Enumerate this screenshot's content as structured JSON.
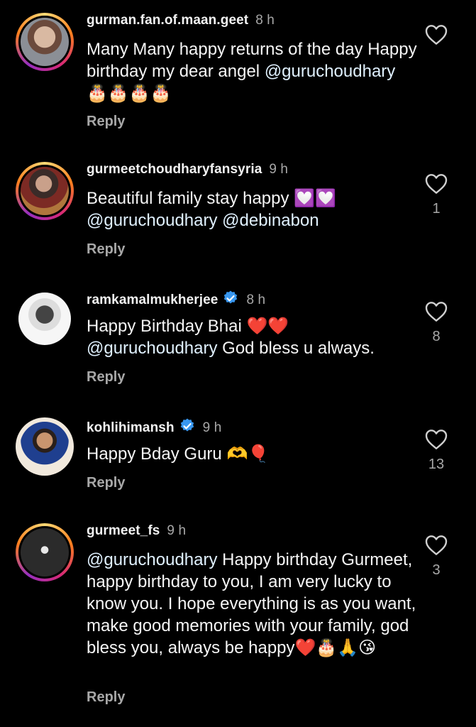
{
  "comments": [
    {
      "username": "gurman.fan.of.maan.geet",
      "time": "8 h",
      "verified": false,
      "text_parts": [
        "Many Many happy returns of the day Happy birthday my dear angel ",
        "@guruchoudhary",
        " 🎂🎂🎂🎂"
      ],
      "likes": "",
      "reply": "Reply"
    },
    {
      "username": "gurmeetchoudharyfansyria",
      "time": "9 h",
      "verified": false,
      "text_parts": [
        "Beautiful family stay happy 💟💟 ",
        "@guruchoudhary @debinabon",
        ""
      ],
      "likes": "1",
      "reply": "Reply"
    },
    {
      "username": "ramkamalmukherjee",
      "time": "8 h",
      "verified": true,
      "text_parts": [
        "Happy Birthday Bhai ❤️❤️ ",
        "@guruchoudhary",
        " God  bless u always."
      ],
      "likes": "8",
      "reply": "Reply"
    },
    {
      "username": "kohlihimansh",
      "time": "9 h",
      "verified": true,
      "text_parts": [
        "Happy Bday Guru 🫶🎈",
        "",
        ""
      ],
      "likes": "13",
      "reply": "Reply"
    },
    {
      "username": "gurmeet_fs",
      "time": "9 h",
      "verified": false,
      "text_parts": [
        "",
        "@guruchoudhary",
        " Happy birthday Gurmeet, happy birthday to you, I am very lucky to know you. I hope everything is as you want, make good memories with your family, god bless you, always be happy❤️🎂🙏😘"
      ],
      "likes": "3",
      "reply": "Reply"
    }
  ],
  "icons": {
    "like": "heart-outline-icon",
    "verified": "verified-badge-icon"
  },
  "colors": {
    "background": "#000000",
    "text": "#f5f5f5",
    "muted": "#a8a8a8",
    "mention": "#e0f1ff",
    "verified": "#3897f0"
  }
}
